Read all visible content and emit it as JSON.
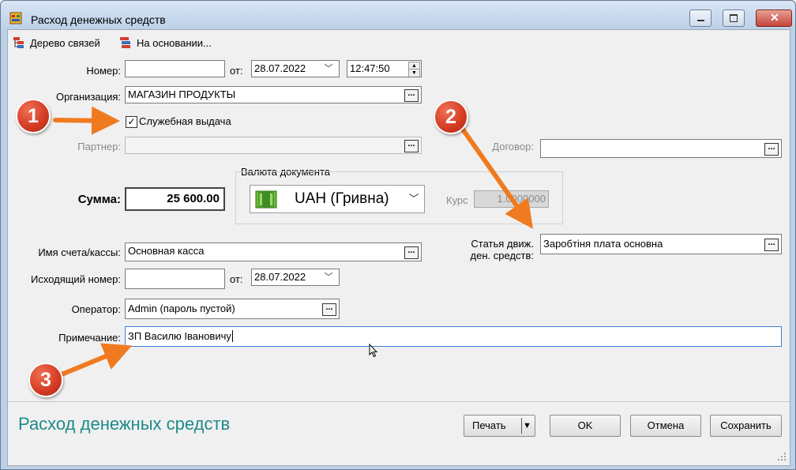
{
  "window": {
    "title": "Расход денежных средств"
  },
  "toolbar": {
    "links_tree": "Дерево связей",
    "based_on": "На основании..."
  },
  "form": {
    "number_label": "Номер:",
    "number_value": "",
    "from_label": "от:",
    "date_value": "28.07.2022",
    "time_value": "12:47:50",
    "org_label": "Организация:",
    "org_value": "МАГАЗИН ПРОДУКТЫ",
    "service_issue_label": "Служебная выдача",
    "service_issue_checked": true,
    "partner_label": "Партнер:",
    "partner_value": "",
    "contract_label": "Договор:",
    "contract_value": "",
    "currency_group_label": "Валюта документа",
    "currency_value": "UAH (Гривна)",
    "rate_label": "Курс",
    "rate_value": "1.0000000",
    "sum_label": "Сумма:",
    "sum_value": "25 600.00",
    "account_label": "Имя счета/кассы:",
    "account_value": "Основная касса",
    "cashflow_label_line1": "Статья движ.",
    "cashflow_label_line2": "ден. средств:",
    "cashflow_value": "Заробтіня плата основна",
    "outgoing_label": "Исходящий номер:",
    "outgoing_value": "",
    "outgoing_from_label": "от:",
    "outgoing_date_value": "28.07.2022",
    "operator_label": "Оператор:",
    "operator_value": "Admin (пароль пустой)",
    "note_label": "Примечание:",
    "note_value": "ЗП Василю Івановичу",
    "dots": "..."
  },
  "footer": {
    "caption": "Расход денежных средств",
    "print_label": "Печать",
    "ok_label": "OK",
    "cancel_label": "Отмена",
    "save_label": "Сохранить"
  },
  "annotations": {
    "badge1": "1",
    "badge2": "2",
    "badge3": "3"
  },
  "colors": {
    "footer_caption": "#1f8a8a",
    "arrow": "#f07a20",
    "badge": "#d33a22",
    "focus_border": "#3b82d8"
  }
}
